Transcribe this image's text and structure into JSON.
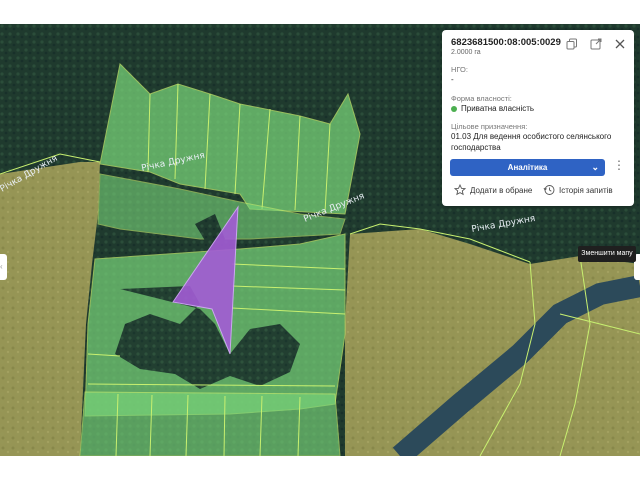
{
  "map": {
    "river_labels": [
      "Річка Дружня",
      "Річка Дружня",
      "Річка Дружня",
      "Річка Дружня"
    ],
    "colors": {
      "forest": "#1f3a2e",
      "field": "#9c9a57",
      "parcel_fill": "#7ad67a",
      "parcel_border": "#c8f070",
      "selected_parcel": "#a35cd6",
      "river": "#2c4a5a"
    }
  },
  "panel": {
    "cadastral_number": "6823681500:08:005:0029",
    "area": "2.0000 га",
    "ngo_label": "НГО:",
    "ngo_value": "-",
    "ownership_label": "Форма власності:",
    "ownership_value": "Приватна власність",
    "ownership_color": "#4caf50",
    "purpose_label": "Цільове призначення:",
    "purpose_value_line1": "01.03 Для ведення особистого селянського",
    "purpose_value_line2": "господарства",
    "analytics_button": "Аналітика",
    "analytics_color": "#2f63c4",
    "favorites_label": "Додати в обране",
    "history_label": "Історія запитів",
    "icons": [
      "copy-icon",
      "external-link-icon",
      "close-icon"
    ]
  },
  "tooltip": {
    "zoom_out_label": "Зменшити мапу"
  }
}
